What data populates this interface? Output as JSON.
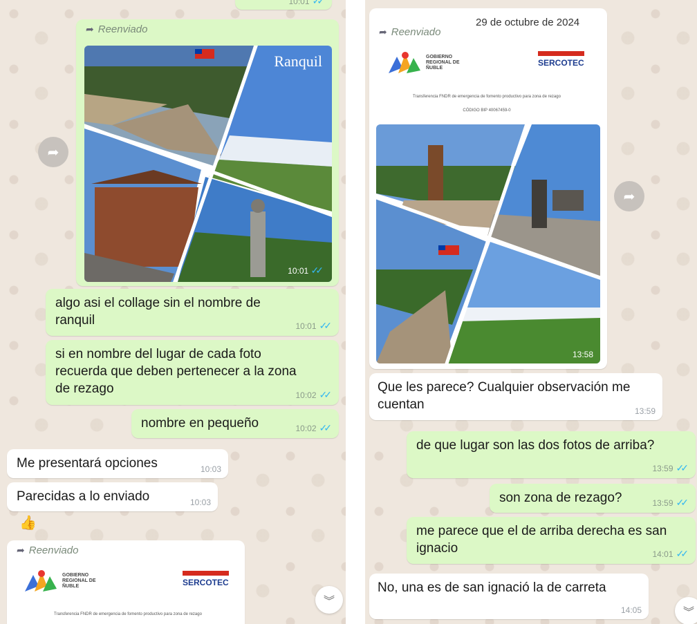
{
  "left": {
    "forwarded_label": "Reenviado",
    "collage_caption": "Ranquil",
    "collage_time": "10:01",
    "top_time": "10:01",
    "messages_out": [
      {
        "text": "algo asi el collage sin el nombre de ranquil",
        "time": "10:01"
      },
      {
        "text": "si en nombre del lugar de cada foto recuerda que deben pertenecer  a la zona de rezago",
        "time": "10:02"
      },
      {
        "text": "nombre en pequeño",
        "time": "10:02"
      }
    ],
    "messages_in": [
      {
        "text": "Me presentará opciones",
        "time": "10:03"
      },
      {
        "text": "Parecidas a lo enviado",
        "time": "10:03"
      }
    ],
    "reaction": "👍",
    "forwarded_label_2": "Reenviado",
    "doc_caption": "Transferencia FNDR de emergencia de fomento productivo para zona de rezago",
    "gob_logo_text": "GOBIERNO REGIONAL DE ÑUBLE",
    "sercotec_text": "SERCOTEC"
  },
  "right": {
    "date_chip": "29 de octubre de 2024",
    "forwarded_label": "Reenviado",
    "gob_logo_text": "GOBIERNO REGIONAL DE ÑUBLE",
    "sercotec_text": "SERCOTEC",
    "doc_caption": "Transferencia FNDR de emergencia de fomento productivo para zona de rezago",
    "doc_code": "CÓDIGO BIP 40067459-0",
    "collage_time": "13:58",
    "messages_in": [
      {
        "text": "Que les parece? Cualquier observación me cuentan",
        "time": "13:59"
      },
      {
        "text": "No, una es de san ignació la de carreta",
        "time": "14:05"
      }
    ],
    "messages_out": [
      {
        "text": "de que lugar son las dos fotos de arriba?",
        "time": "13:59"
      },
      {
        "text": "son zona de rezago?",
        "time": "13:59"
      },
      {
        "text": "me parece que el de  arriba  derecha es san ignacio",
        "time": "14:01"
      }
    ]
  },
  "icons": {
    "share": "share-icon",
    "scroll_down": "chevron-double-down-icon",
    "forwarded": "forward-arrow-icon",
    "read_ticks": "double-check-icon"
  },
  "colors": {
    "outgoing_bubble": "#dcf8c6",
    "incoming_bubble": "#ffffff",
    "tick_blue": "#34b7f1",
    "chat_background": "#efe7de"
  }
}
